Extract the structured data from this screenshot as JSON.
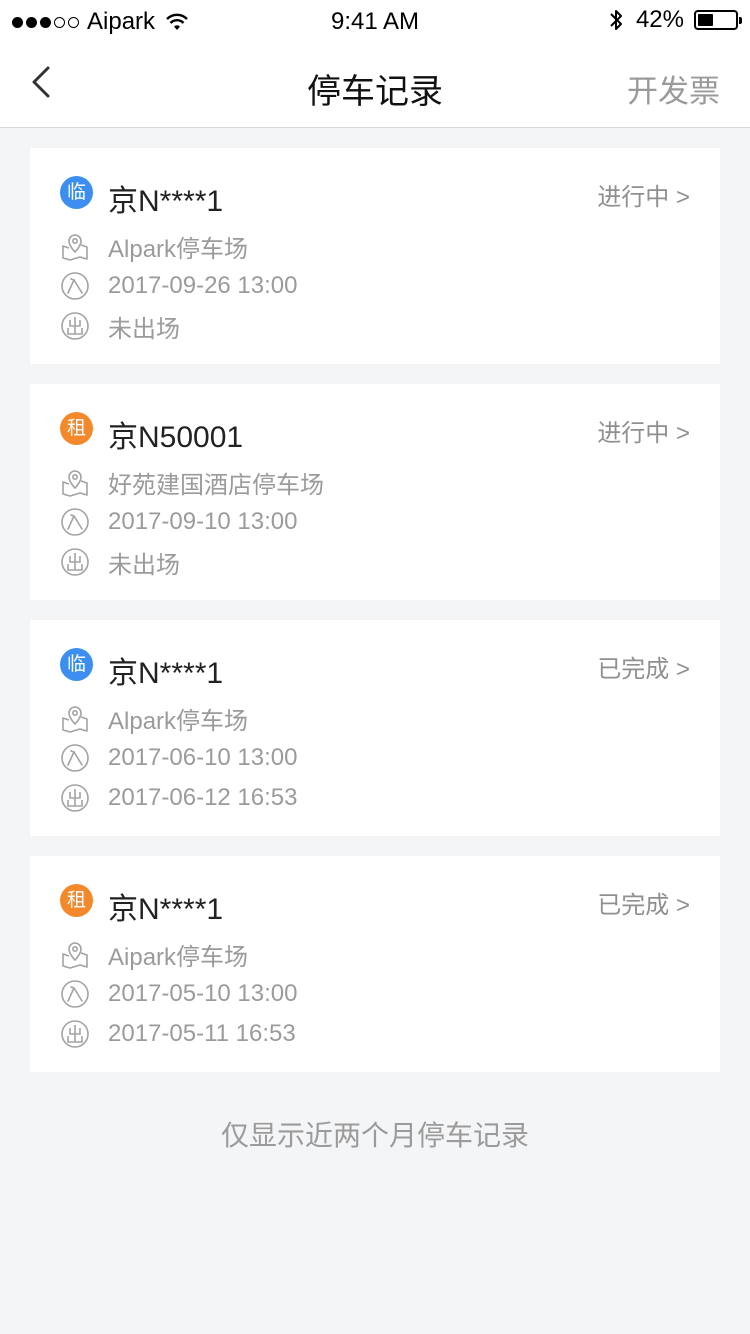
{
  "status_bar": {
    "carrier": "Aipark",
    "time": "9:41 AM",
    "battery_percent": "42%",
    "battery_level": 0.42
  },
  "nav": {
    "title": "停车记录",
    "invoice_label": "开发票",
    "back_icon": "chevron-left-icon"
  },
  "records": [
    {
      "type_badge": "临",
      "type_color": "#3c8ef0",
      "plate": "京N****1",
      "status": "进行中 >",
      "lot": "Alpark停车场",
      "entry": "2017-09-26 13:00",
      "exit": "未出场"
    },
    {
      "type_badge": "租",
      "type_color": "#f3892b",
      "plate": "京N50001",
      "status": "进行中 >",
      "lot": "好苑建国酒店停车场",
      "entry": "2017-09-10 13:00",
      "exit": "未出场"
    },
    {
      "type_badge": "临",
      "type_color": "#3c8ef0",
      "plate": "京N****1",
      "status": "已完成 >",
      "lot": "Alpark停车场",
      "entry": "2017-06-10 13:00",
      "exit": "2017-06-12 16:53"
    },
    {
      "type_badge": "租",
      "type_color": "#f3892b",
      "plate": "京N****1",
      "status": "已完成 >",
      "lot": "Aipark停车场",
      "entry": "2017-05-10 13:00",
      "exit": "2017-05-11 16:53"
    }
  ],
  "footer_note": "仅显示近两个月停车记录"
}
